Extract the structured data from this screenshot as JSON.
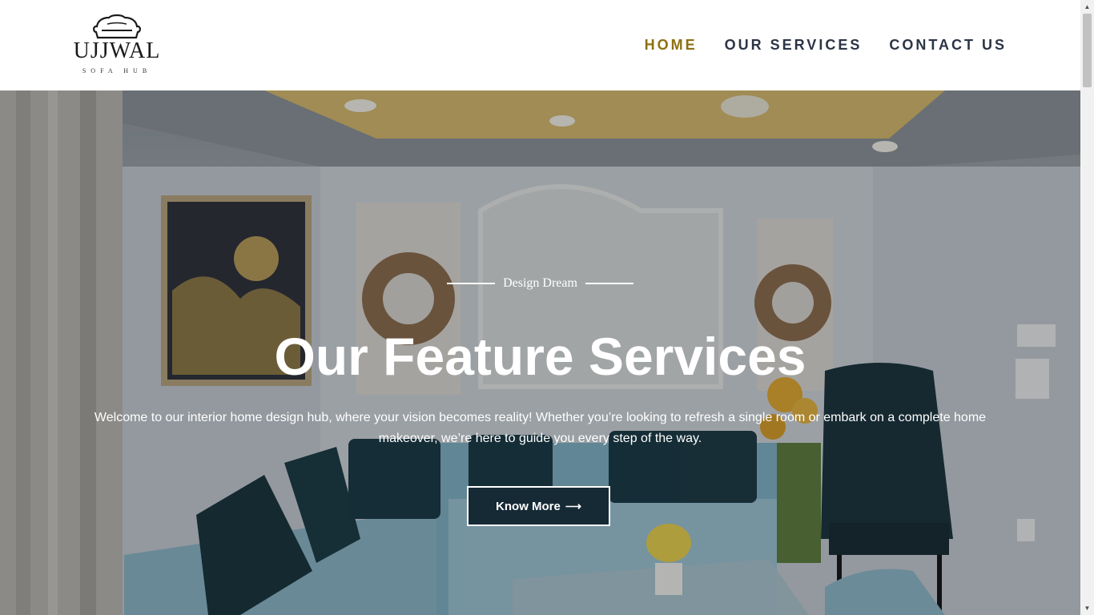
{
  "logo": {
    "name": "UJJWAL",
    "tagline": "SOFA HUB"
  },
  "nav": {
    "items": [
      {
        "label": "HOME",
        "active": true
      },
      {
        "label": "OUR SERVICES",
        "active": false
      },
      {
        "label": "CONTACT US",
        "active": false
      }
    ]
  },
  "hero": {
    "eyebrow": "Design Dream",
    "title": "Our Feature Services",
    "description": "Welcome to our interior home design hub, where your vision becomes reality! Whether you’re looking to refresh a single room or embark on a complete home makeover, we’re here to guide you every step of the way.",
    "button_label": "Know More",
    "button_icon": "arrow-right-icon"
  },
  "colors": {
    "nav_active": "#8d7012",
    "nav_default": "#2b3545",
    "button_bg": "#162a36"
  }
}
